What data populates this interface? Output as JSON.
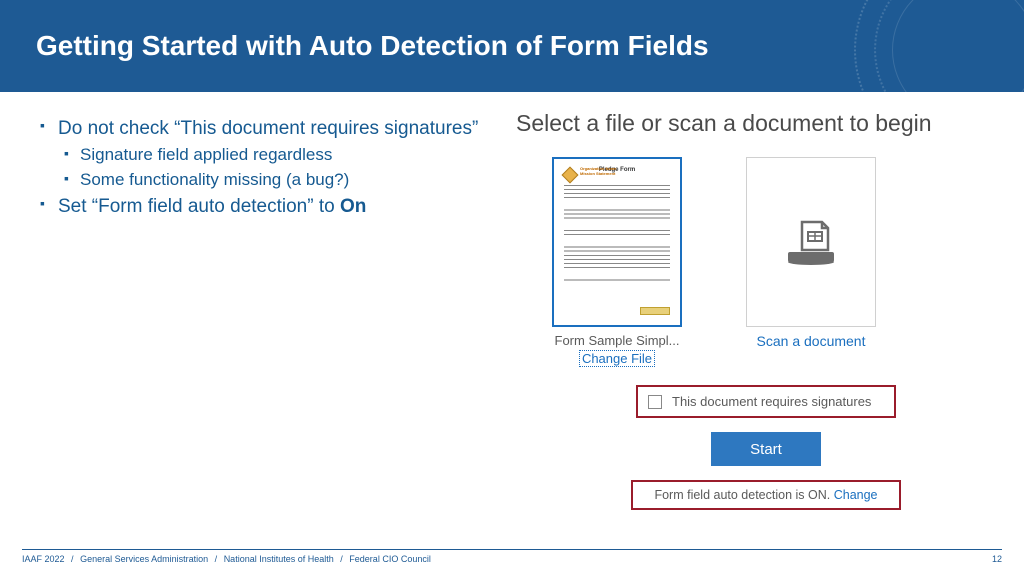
{
  "header": {
    "title": "Getting Started with Auto Detection of Form Fields"
  },
  "bullets": {
    "item1": "Do not check “This document requires signatures”",
    "item1_sub1": "Signature field applied regardless",
    "item1_sub2": "Some functionality missing (a bug?)",
    "item2_prefix": "Set “Form field auto detection” to ",
    "item2_bold": "On"
  },
  "panel": {
    "title": "Select a file or scan a document to begin",
    "file_thumb_title": "Pledge Form",
    "file_label": "Form Sample Simpl...",
    "change_file": "Change File",
    "scan_label": "Scan a document",
    "checkbox_label": "This document requires signatures",
    "start_label": "Start",
    "auto_detect_text": "Form field auto detection is ON. ",
    "auto_detect_link": "Change"
  },
  "footer": {
    "conf": "IAAF 2022",
    "org1": "General Services Administration",
    "org2": "National Institutes of Health",
    "org3": "Federal CIO Council",
    "page": "12"
  }
}
